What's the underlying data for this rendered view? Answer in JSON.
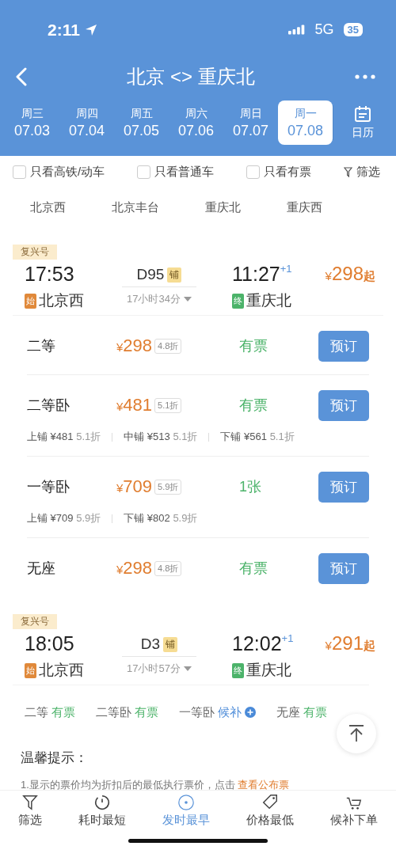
{
  "status_bar": {
    "time": "2:11",
    "network": "5G",
    "battery": "35"
  },
  "nav": {
    "title": "北京 <> 重庆北"
  },
  "dates": [
    {
      "weekday": "周三",
      "date": "07.03",
      "selected": false
    },
    {
      "weekday": "周四",
      "date": "07.04",
      "selected": false
    },
    {
      "weekday": "周五",
      "date": "07.05",
      "selected": false
    },
    {
      "weekday": "周六",
      "date": "07.06",
      "selected": false
    },
    {
      "weekday": "周日",
      "date": "07.07",
      "selected": false
    },
    {
      "weekday": "周一",
      "date": "07.08",
      "selected": true
    }
  ],
  "calendar_label": "日历",
  "filters": [
    {
      "label": "只看高铁/动车",
      "checked": false
    },
    {
      "label": "只看普通车",
      "checked": false
    },
    {
      "label": "只看有票",
      "checked": false
    }
  ],
  "filter_button": "筛选",
  "stations": [
    "北京西",
    "北京丰台",
    "重庆北",
    "重庆西"
  ],
  "trains": [
    {
      "brand": "复兴号",
      "depart_time": "17:53",
      "start_badge": "始",
      "depart_station": "北京西",
      "train_no": "D95",
      "berth_badge": "铺",
      "duration": "17小时34分",
      "arrive_time": "11:27",
      "day_offset": "+1",
      "end_badge": "终",
      "arrive_station": "重庆北",
      "currency": "¥",
      "price": "298",
      "price_suffix": "起",
      "expanded": true,
      "seats": [
        {
          "class": "二等",
          "currency": "¥",
          "price": "298",
          "discount": "4.8折",
          "availability": "有票",
          "book": "预订"
        },
        {
          "class": "二等卧",
          "currency": "¥",
          "price": "481",
          "discount": "5.1折",
          "availability": "有票",
          "book": "预订",
          "berths": [
            {
              "name": "上铺",
              "price": "¥481",
              "discount": "5.1折"
            },
            {
              "name": "中铺",
              "price": "¥513",
              "discount": "5.1折"
            },
            {
              "name": "下铺",
              "price": "¥561",
              "discount": "5.1折"
            }
          ]
        },
        {
          "class": "一等卧",
          "currency": "¥",
          "price": "709",
          "discount": "5.9折",
          "availability": "1张",
          "book": "预订",
          "berths": [
            {
              "name": "上铺",
              "price": "¥709",
              "discount": "5.9折"
            },
            {
              "name": "下铺",
              "price": "¥802",
              "discount": "5.9折"
            }
          ]
        },
        {
          "class": "无座",
          "currency": "¥",
          "price": "298",
          "discount": "4.8折",
          "availability": "有票",
          "book": "预订"
        }
      ]
    },
    {
      "brand": "复兴号",
      "depart_time": "18:05",
      "start_badge": "始",
      "depart_station": "北京西",
      "train_no": "D3",
      "berth_badge": "铺",
      "duration": "17小时57分",
      "arrive_time": "12:02",
      "day_offset": "+1",
      "end_badge": "终",
      "arrive_station": "重庆北",
      "currency": "¥",
      "price": "291",
      "price_suffix": "起",
      "expanded": false,
      "summary": [
        {
          "class": "二等",
          "availability": "有票",
          "kind": "available"
        },
        {
          "class": "二等卧",
          "availability": "有票",
          "kind": "available"
        },
        {
          "class": "一等卧",
          "availability": "候补",
          "kind": "waitlist"
        },
        {
          "class": "无座",
          "availability": "有票",
          "kind": "available"
        }
      ]
    }
  ],
  "tips": {
    "title": "温馨提示：",
    "text": "1.显示的票价均为折扣后的最低执行票价，点击",
    "link": "查看公布票"
  },
  "tab_bar": [
    {
      "label": "筛选",
      "kind": "filter",
      "selected": false
    },
    {
      "label": "耗时最短",
      "kind": "timer",
      "selected": false
    },
    {
      "label": "发时最早",
      "kind": "clock",
      "selected": true
    },
    {
      "label": "价格最低",
      "kind": "tag",
      "selected": false
    },
    {
      "label": "候补下单",
      "kind": "cart",
      "selected": false
    }
  ]
}
